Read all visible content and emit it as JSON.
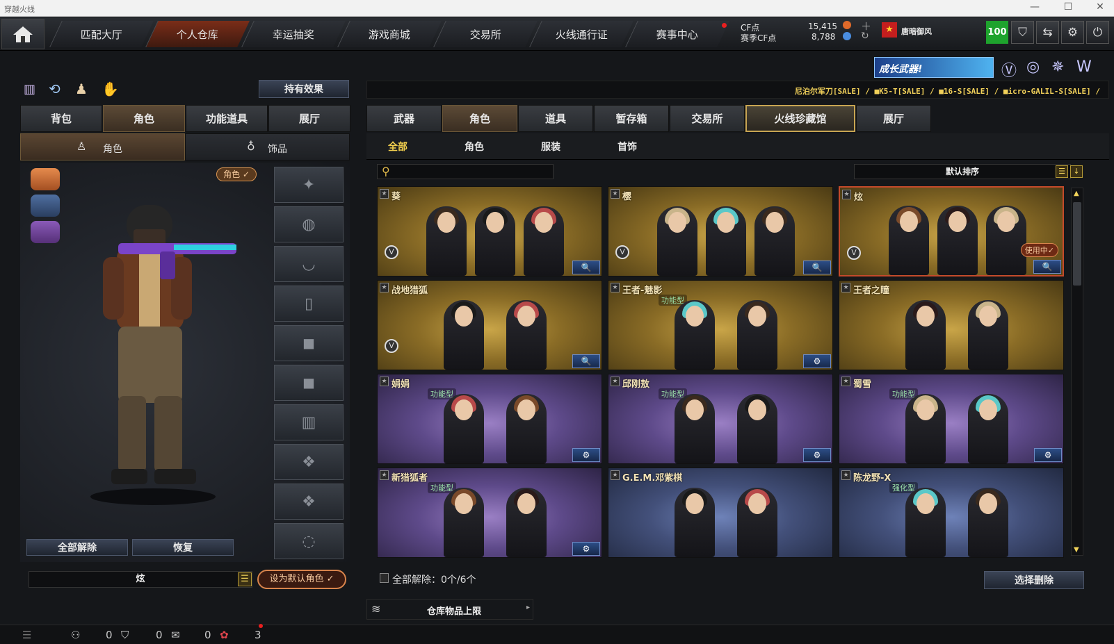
{
  "window": {
    "title": "穿越火线",
    "min": "—",
    "max": "☐",
    "close": "✕"
  },
  "nav": {
    "tabs": [
      "匹配大厅",
      "个人仓库",
      "幸运抽奖",
      "游戏商城",
      "交易所",
      "火线通行证",
      "赛事中心"
    ],
    "cf_label": "CF点",
    "cf_value": "15,415",
    "season_label": "赛季CF点",
    "season_value": "8,788",
    "username": "唐暗御风",
    "level": "100"
  },
  "promo": {
    "banner": "成长武器!",
    "ticker": "尼泊尔军刀[SALE] / ■K5-T[SALE] / ■16-S[SALE] / ■icro-GALIL-S[SALE] /"
  },
  "left": {
    "effects_button": "持有效果",
    "tabs": [
      "背包",
      "角色",
      "功能道具",
      "展厅"
    ],
    "subtabs": [
      "角色",
      "饰品"
    ],
    "role_badge": "角色 ✓",
    "release_all": "全部解除",
    "restore": "恢复",
    "current_role": "炫",
    "set_default": "设为默认角色 ✓"
  },
  "right": {
    "tabs": [
      "武器",
      "角色",
      "道具",
      "暂存箱",
      "交易所",
      "火线珍藏馆",
      "展厅"
    ],
    "subtabs": [
      "全部",
      "角色",
      "服装",
      "首饰"
    ],
    "search_placeholder": "",
    "sort": "默认排序",
    "cards": [
      {
        "name": "葵",
        "bg": "gold",
        "badge": "",
        "v": true,
        "btn": "🔍",
        "inuse": ""
      },
      {
        "name": "樱",
        "bg": "gold",
        "badge": "",
        "v": true,
        "btn": "🔍",
        "inuse": ""
      },
      {
        "name": "炫",
        "bg": "gold",
        "badge": "",
        "v": true,
        "btn": "🔍",
        "inuse": "使用中✓"
      },
      {
        "name": "战地猎狐",
        "bg": "gold",
        "badge": "",
        "v": true,
        "btn": "🔍",
        "inuse": ""
      },
      {
        "name": "王者-魅影",
        "bg": "gold",
        "badge": "功能型",
        "v": false,
        "btn": "⚙",
        "inuse": ""
      },
      {
        "name": "王者之瞳",
        "bg": "gold",
        "badge": "",
        "v": false,
        "btn": "",
        "inuse": ""
      },
      {
        "name": "娟娟",
        "bg": "purple",
        "badge": "功能型",
        "v": false,
        "btn": "⚙",
        "inuse": ""
      },
      {
        "name": "邱刚敖",
        "bg": "purple",
        "badge": "功能型",
        "v": false,
        "btn": "⚙",
        "inuse": ""
      },
      {
        "name": "蜀雪",
        "bg": "purple",
        "badge": "功能型",
        "v": false,
        "btn": "⚙",
        "inuse": ""
      },
      {
        "name": "新猎狐者",
        "bg": "purple",
        "badge": "功能型",
        "v": false,
        "btn": "⚙",
        "inuse": ""
      },
      {
        "name": "G.E.M.邓紫棋",
        "bg": "blue",
        "badge": "",
        "v": false,
        "btn": "",
        "inuse": ""
      },
      {
        "name": "陈龙野-X",
        "bg": "blue",
        "badge": "强化型",
        "v": false,
        "btn": "",
        "inuse": ""
      }
    ],
    "release_all": "全部解除：0个/6个",
    "select_delete": "选择删除",
    "capacity": "仓库物品上限"
  },
  "bottom": {
    "count1": "0",
    "count2": "0",
    "count3": "0",
    "gifts": "3"
  }
}
